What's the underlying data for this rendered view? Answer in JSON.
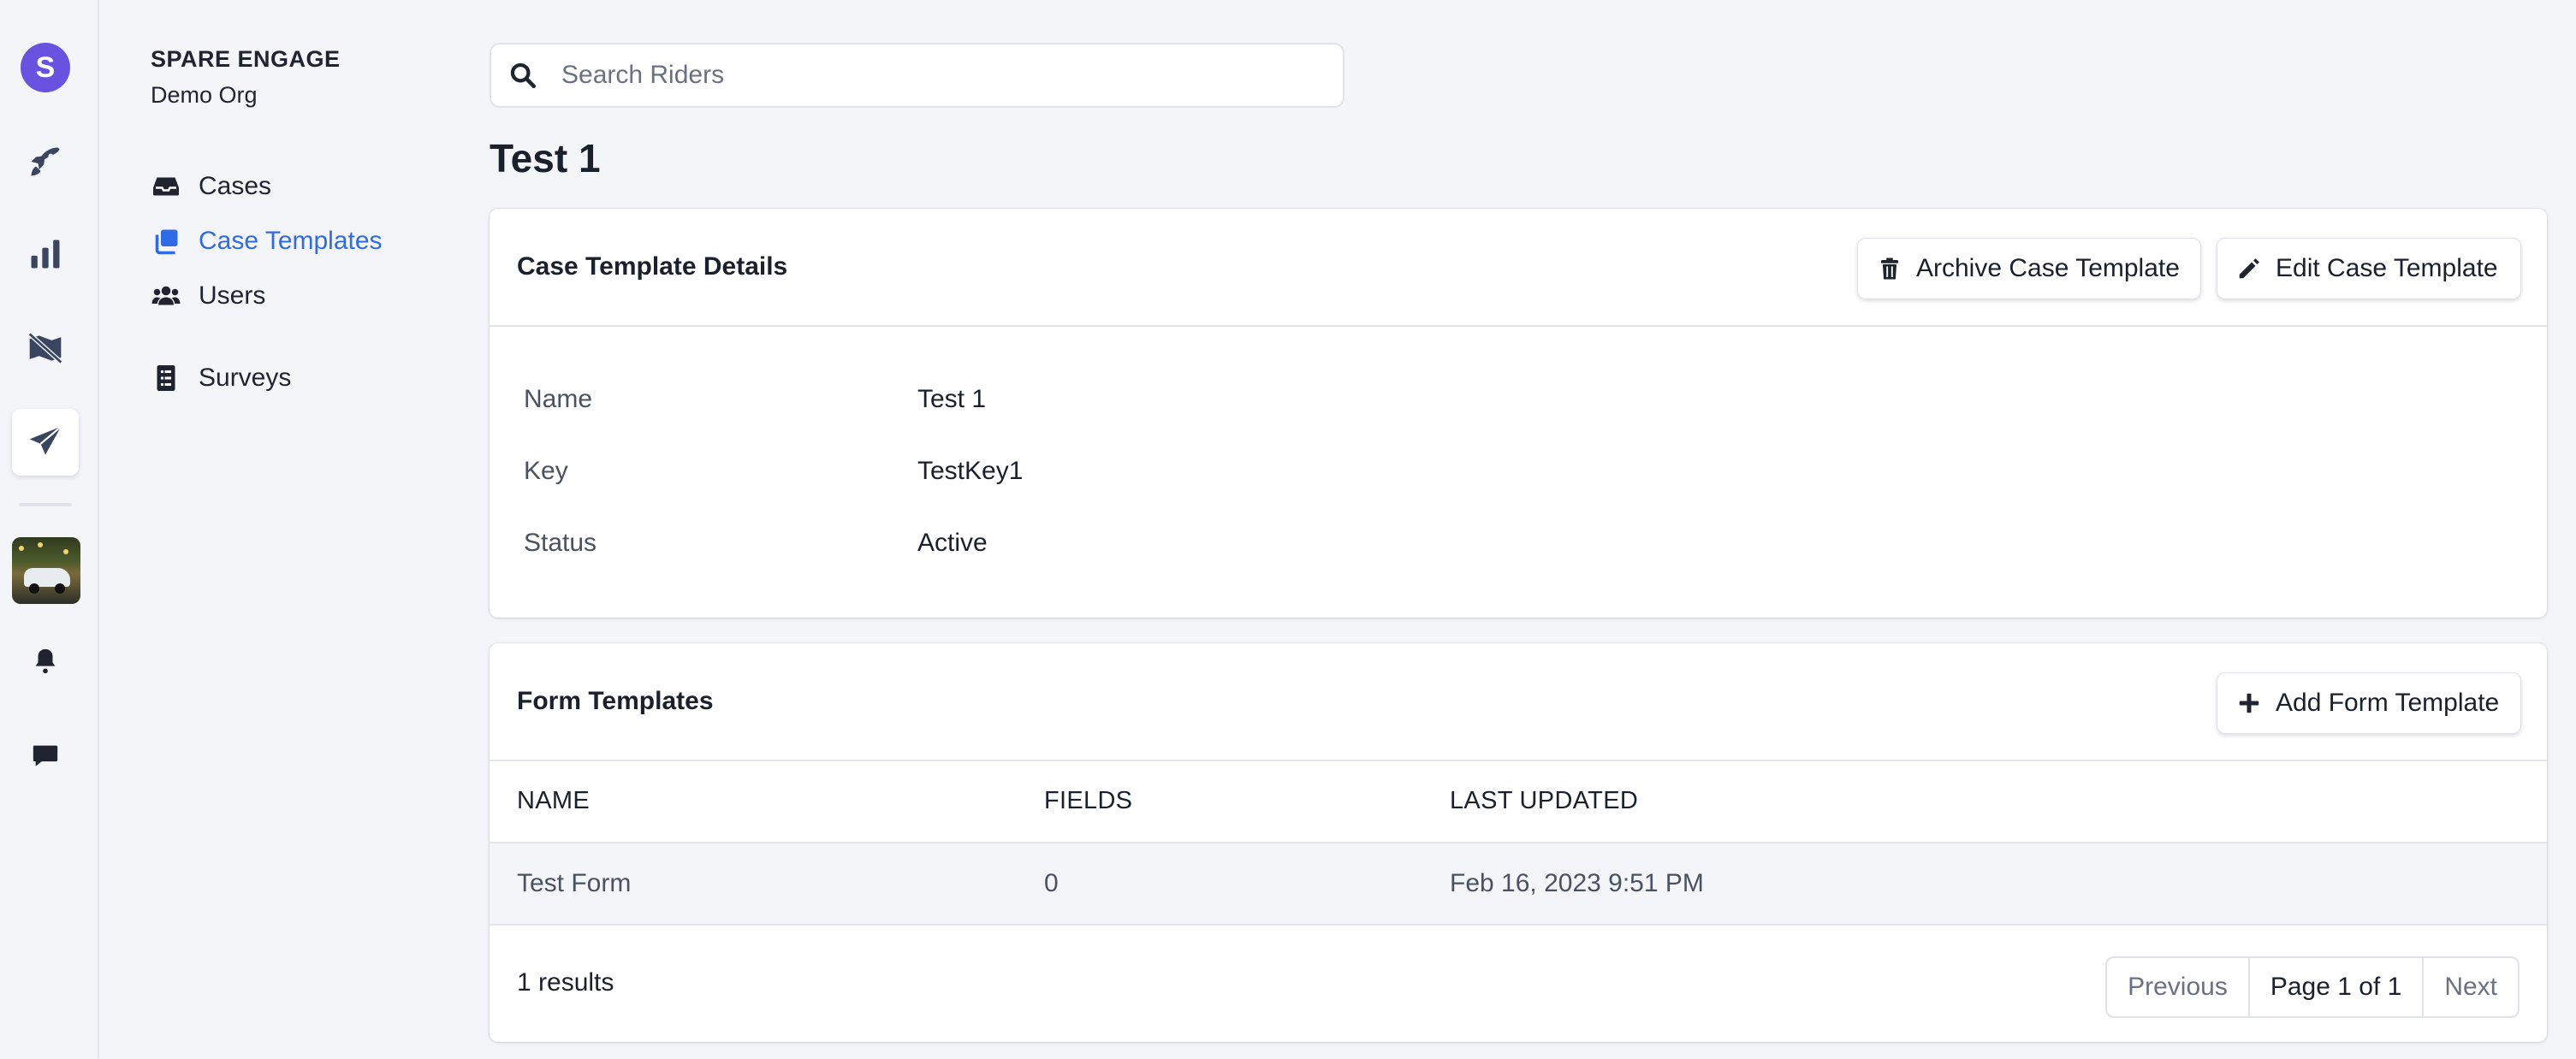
{
  "rail": {
    "avatar_letter": "S",
    "avatar_color": "#6a52e0",
    "items": [
      {
        "icon": "rocket-icon"
      },
      {
        "icon": "bar-chart-icon"
      },
      {
        "icon": "map-off-icon"
      },
      {
        "icon": "paper-plane-icon",
        "active": true
      },
      {
        "icon": "org-photo"
      },
      {
        "icon": "bell-icon"
      },
      {
        "icon": "chat-icon"
      }
    ]
  },
  "nav": {
    "org_name": "SPARE ENGAGE",
    "org_sub": "Demo Org",
    "items": [
      {
        "label": "Cases",
        "icon": "inbox-icon"
      },
      {
        "label": "Case Templates",
        "icon": "copy-icon",
        "active": true
      },
      {
        "label": "Users",
        "icon": "users-icon"
      },
      {
        "label": "Surveys",
        "icon": "survey-icon"
      }
    ],
    "active_color": "#2f6be6"
  },
  "search": {
    "placeholder": "Search Riders",
    "value": ""
  },
  "page_title": "Test 1",
  "details_card": {
    "title": "Case Template Details",
    "archive_label": "Archive Case Template",
    "edit_label": "Edit Case Template",
    "rows": [
      {
        "label": "Name",
        "value": "Test 1"
      },
      {
        "label": "Key",
        "value": "TestKey1"
      },
      {
        "label": "Status",
        "value": "Active"
      }
    ]
  },
  "forms_card": {
    "title": "Form Templates",
    "add_label": "Add Form Template",
    "columns": [
      "NAME",
      "FIELDS",
      "LAST UPDATED"
    ],
    "rows": [
      {
        "name": "Test Form",
        "fields": "0",
        "updated": "Feb 16, 2023 9:51 PM"
      }
    ],
    "results": "1 results",
    "pager": {
      "prev": "Previous",
      "page": "Page 1 of 1",
      "next": "Next"
    }
  }
}
